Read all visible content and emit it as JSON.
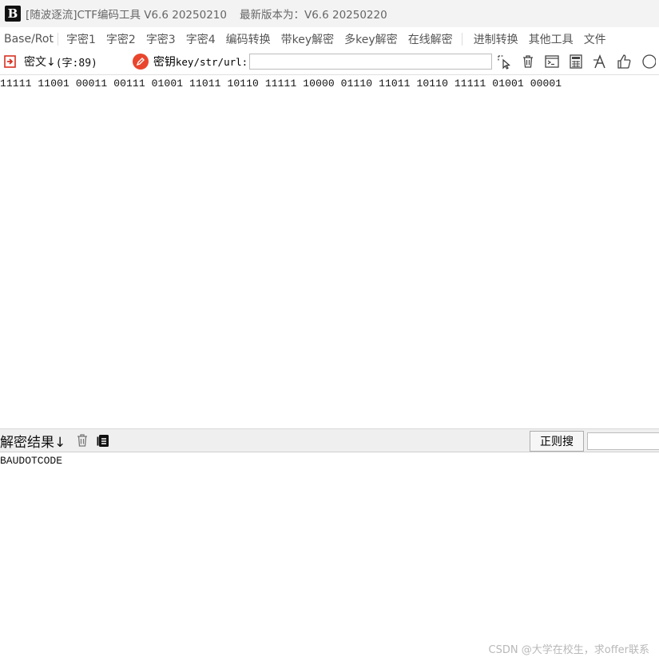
{
  "window": {
    "title": "[随波逐流]CTF编码工具 V6.6 20250210",
    "latest_version": "最新版本为：V6.6 20250220"
  },
  "menu": {
    "items": [
      "Base/Rot",
      "字密1",
      "字密2",
      "字密3",
      "字密4",
      "编码转换",
      "带key解密",
      "多key解密",
      "在线解密",
      "进制转换",
      "其他工具",
      "文件"
    ]
  },
  "toolbar": {
    "ciphertext_label": "密文↓",
    "char_count": "(字:89)",
    "key_label_prefix": "密钥",
    "key_label_mono": "key/str/url:",
    "key_value": ""
  },
  "cipher": {
    "text": "11111 11001 00011 00111 01001 11011 10110 11111 10000 01110 11011 10110 11111 01001 00001"
  },
  "result": {
    "label": "解密结果↓",
    "regex_button": "正则搜",
    "regex_value": "",
    "text": "BAUDOTCODE"
  },
  "watermark": "CSDN @大学在校生，求offer联系",
  "colors": {
    "accent_red": "#e9452d",
    "title_bg": "#f3f3f3",
    "result_bar_bg": "#efefef"
  },
  "icons": [
    "app-logo-icon",
    "ciphertext-arrow-icon",
    "key-pencil-icon",
    "select-cursor-icon",
    "trash-icon",
    "terminal-icon",
    "calculator-icon",
    "font-icon",
    "thumbs-up-icon",
    "clock-icon",
    "result-trash-icon",
    "copy-icon"
  ]
}
